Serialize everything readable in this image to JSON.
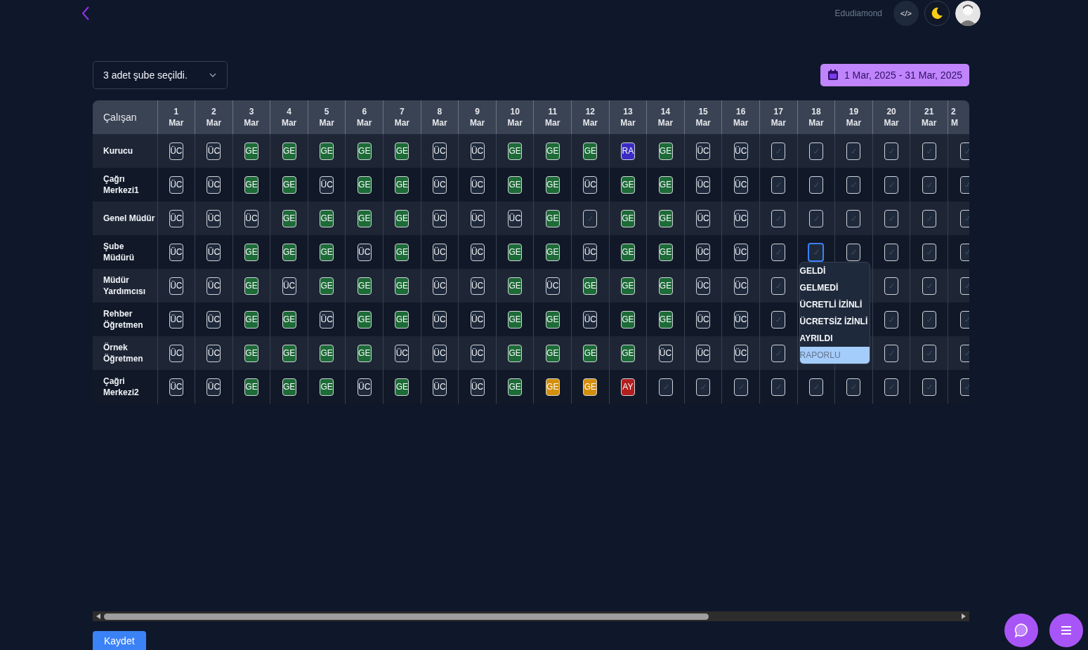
{
  "header": {
    "brand": "Edudiamond",
    "code_button": "</>"
  },
  "branch_select": {
    "value": "3 adet şube seçildi."
  },
  "date_range": {
    "value": "1 Mar, 2025 - 31 Mar, 2025"
  },
  "table": {
    "name_column": "Çalışan",
    "columns": [
      {
        "day": "1",
        "month": "Mar"
      },
      {
        "day": "2",
        "month": "Mar"
      },
      {
        "day": "3",
        "month": "Mar"
      },
      {
        "day": "4",
        "month": "Mar"
      },
      {
        "day": "5",
        "month": "Mar"
      },
      {
        "day": "6",
        "month": "Mar"
      },
      {
        "day": "7",
        "month": "Mar"
      },
      {
        "day": "8",
        "month": "Mar"
      },
      {
        "day": "9",
        "month": "Mar"
      },
      {
        "day": "10",
        "month": "Mar"
      },
      {
        "day": "11",
        "month": "Mar"
      },
      {
        "day": "12",
        "month": "Mar"
      },
      {
        "day": "13",
        "month": "Mar"
      },
      {
        "day": "14",
        "month": "Mar"
      },
      {
        "day": "15",
        "month": "Mar"
      },
      {
        "day": "16",
        "month": "Mar"
      },
      {
        "day": "17",
        "month": "Mar"
      },
      {
        "day": "18",
        "month": "Mar"
      },
      {
        "day": "19",
        "month": "Mar"
      },
      {
        "day": "20",
        "month": "Mar"
      },
      {
        "day": "21",
        "month": "Mar"
      },
      {
        "day": "2",
        "month": "M"
      }
    ],
    "rows": [
      {
        "name": "Kurucu",
        "cells": [
          {
            "kind": "outline",
            "text": "ÜC"
          },
          {
            "kind": "outline",
            "text": "ÜC"
          },
          {
            "kind": "filled",
            "text": "GE",
            "color": "#1d6b37"
          },
          {
            "kind": "filled",
            "text": "GE",
            "color": "#1d6b37"
          },
          {
            "kind": "filled",
            "text": "GE",
            "color": "#1d6b37"
          },
          {
            "kind": "filled",
            "text": "GE",
            "color": "#1d6b37"
          },
          {
            "kind": "filled",
            "text": "GE",
            "color": "#1d6b37"
          },
          {
            "kind": "outline",
            "text": "ÜC"
          },
          {
            "kind": "outline",
            "text": "ÜC"
          },
          {
            "kind": "filled",
            "text": "GE",
            "color": "#1d6b37"
          },
          {
            "kind": "filled",
            "text": "GE",
            "color": "#1d6b37"
          },
          {
            "kind": "filled",
            "text": "GE",
            "color": "#1d6b37"
          },
          {
            "kind": "filled",
            "text": "RA",
            "color": "#3b2bc4"
          },
          {
            "kind": "filled",
            "text": "GE",
            "color": "#1d6b37"
          },
          {
            "kind": "outline",
            "text": "ÜC"
          },
          {
            "kind": "outline",
            "text": "ÜC"
          },
          {
            "kind": "empty"
          },
          {
            "kind": "empty"
          },
          {
            "kind": "empty"
          },
          {
            "kind": "empty"
          },
          {
            "kind": "empty"
          },
          {
            "kind": "empty"
          }
        ]
      },
      {
        "name": "Çağrı Merkezi1",
        "cells": [
          {
            "kind": "outline",
            "text": "ÜC"
          },
          {
            "kind": "outline",
            "text": "ÜC"
          },
          {
            "kind": "filled",
            "text": "GE",
            "color": "#1d6b37"
          },
          {
            "kind": "filled",
            "text": "GE",
            "color": "#1d6b37"
          },
          {
            "kind": "outline",
            "text": "ÜC"
          },
          {
            "kind": "filled",
            "text": "GE",
            "color": "#1d6b37"
          },
          {
            "kind": "filled",
            "text": "GE",
            "color": "#1d6b37"
          },
          {
            "kind": "outline",
            "text": "ÜC"
          },
          {
            "kind": "outline",
            "text": "ÜC"
          },
          {
            "kind": "filled",
            "text": "GE",
            "color": "#1d6b37"
          },
          {
            "kind": "filled",
            "text": "GE",
            "color": "#1d6b37"
          },
          {
            "kind": "outline",
            "text": "ÜC"
          },
          {
            "kind": "filled",
            "text": "GE",
            "color": "#1d6b37"
          },
          {
            "kind": "filled",
            "text": "GE",
            "color": "#1d6b37"
          },
          {
            "kind": "outline",
            "text": "ÜC"
          },
          {
            "kind": "outline",
            "text": "ÜC"
          },
          {
            "kind": "empty"
          },
          {
            "kind": "empty"
          },
          {
            "kind": "empty"
          },
          {
            "kind": "empty"
          },
          {
            "kind": "empty"
          },
          {
            "kind": "empty"
          }
        ]
      },
      {
        "name": "Genel Müdür",
        "cells": [
          {
            "kind": "outline",
            "text": "ÜC"
          },
          {
            "kind": "outline",
            "text": "ÜC"
          },
          {
            "kind": "outline",
            "text": "ÜC"
          },
          {
            "kind": "filled",
            "text": "GE",
            "color": "#1d6b37"
          },
          {
            "kind": "filled",
            "text": "GE",
            "color": "#1d6b37"
          },
          {
            "kind": "filled",
            "text": "GE",
            "color": "#1d6b37"
          },
          {
            "kind": "filled",
            "text": "GE",
            "color": "#1d6b37"
          },
          {
            "kind": "outline",
            "text": "ÜC"
          },
          {
            "kind": "outline",
            "text": "ÜC"
          },
          {
            "kind": "outline",
            "text": "ÜC"
          },
          {
            "kind": "filled",
            "text": "GE",
            "color": "#1d6b37"
          },
          {
            "kind": "empty"
          },
          {
            "kind": "filled",
            "text": "GE",
            "color": "#1d6b37"
          },
          {
            "kind": "filled",
            "text": "GE",
            "color": "#1d6b37"
          },
          {
            "kind": "outline",
            "text": "ÜC"
          },
          {
            "kind": "outline",
            "text": "ÜC"
          },
          {
            "kind": "empty"
          },
          {
            "kind": "empty"
          },
          {
            "kind": "empty"
          },
          {
            "kind": "empty"
          },
          {
            "kind": "empty"
          },
          {
            "kind": "empty"
          }
        ]
      },
      {
        "name": "Şube Müdürü",
        "cells": [
          {
            "kind": "outline",
            "text": "ÜC"
          },
          {
            "kind": "outline",
            "text": "ÜC"
          },
          {
            "kind": "filled",
            "text": "GE",
            "color": "#1d6b37"
          },
          {
            "kind": "filled",
            "text": "GE",
            "color": "#1d6b37"
          },
          {
            "kind": "filled",
            "text": "GE",
            "color": "#1d6b37"
          },
          {
            "kind": "outline",
            "text": "ÜC"
          },
          {
            "kind": "filled",
            "text": "GE",
            "color": "#1d6b37"
          },
          {
            "kind": "outline",
            "text": "ÜC"
          },
          {
            "kind": "outline",
            "text": "ÜC"
          },
          {
            "kind": "filled",
            "text": "GE",
            "color": "#1d6b37"
          },
          {
            "kind": "filled",
            "text": "GE",
            "color": "#1d6b37"
          },
          {
            "kind": "outline",
            "text": "ÜC"
          },
          {
            "kind": "filled",
            "text": "GE",
            "color": "#1d6b37"
          },
          {
            "kind": "filled",
            "text": "GE",
            "color": "#1d6b37"
          },
          {
            "kind": "outline",
            "text": "ÜC"
          },
          {
            "kind": "outline",
            "text": "ÜC"
          },
          {
            "kind": "empty"
          },
          {
            "kind": "focused"
          },
          {
            "kind": "empty"
          },
          {
            "kind": "empty"
          },
          {
            "kind": "empty"
          },
          {
            "kind": "empty"
          }
        ]
      },
      {
        "name": "Müdür Yardımcısı",
        "cells": [
          {
            "kind": "outline",
            "text": "ÜC"
          },
          {
            "kind": "outline",
            "text": "ÜC"
          },
          {
            "kind": "filled",
            "text": "GE",
            "color": "#1d6b37"
          },
          {
            "kind": "outline",
            "text": "ÜC"
          },
          {
            "kind": "filled",
            "text": "GE",
            "color": "#1d6b37"
          },
          {
            "kind": "filled",
            "text": "GE",
            "color": "#1d6b37"
          },
          {
            "kind": "filled",
            "text": "GE",
            "color": "#1d6b37"
          },
          {
            "kind": "outline",
            "text": "ÜC"
          },
          {
            "kind": "outline",
            "text": "ÜC"
          },
          {
            "kind": "filled",
            "text": "GE",
            "color": "#1d6b37"
          },
          {
            "kind": "outline",
            "text": "ÜC"
          },
          {
            "kind": "filled",
            "text": "GE",
            "color": "#1d6b37"
          },
          {
            "kind": "filled",
            "text": "GE",
            "color": "#1d6b37"
          },
          {
            "kind": "filled",
            "text": "GE",
            "color": "#1d6b37"
          },
          {
            "kind": "outline",
            "text": "ÜC"
          },
          {
            "kind": "outline",
            "text": "ÜC"
          },
          {
            "kind": "empty"
          },
          null,
          null,
          {
            "kind": "empty"
          },
          {
            "kind": "empty"
          },
          {
            "kind": "empty"
          }
        ]
      },
      {
        "name": "Rehber Öğretmen",
        "cells": [
          {
            "kind": "outline",
            "text": "ÜC"
          },
          {
            "kind": "outline",
            "text": "ÜC"
          },
          {
            "kind": "filled",
            "text": "GE",
            "color": "#1d6b37"
          },
          {
            "kind": "filled",
            "text": "GE",
            "color": "#1d6b37"
          },
          {
            "kind": "outline",
            "text": "ÜC"
          },
          {
            "kind": "filled",
            "text": "GE",
            "color": "#1d6b37"
          },
          {
            "kind": "filled",
            "text": "GE",
            "color": "#1d6b37"
          },
          {
            "kind": "outline",
            "text": "ÜC"
          },
          {
            "kind": "outline",
            "text": "ÜC"
          },
          {
            "kind": "filled",
            "text": "GE",
            "color": "#1d6b37"
          },
          {
            "kind": "filled",
            "text": "GE",
            "color": "#1d6b37"
          },
          {
            "kind": "outline",
            "text": "ÜC"
          },
          {
            "kind": "filled",
            "text": "GE",
            "color": "#1d6b37"
          },
          {
            "kind": "filled",
            "text": "GE",
            "color": "#1d6b37"
          },
          {
            "kind": "outline",
            "text": "ÜC"
          },
          {
            "kind": "outline",
            "text": "ÜC"
          },
          {
            "kind": "empty"
          },
          null,
          null,
          {
            "kind": "empty"
          },
          {
            "kind": "empty"
          },
          {
            "kind": "empty"
          }
        ]
      },
      {
        "name": "Örnek Öğretmen",
        "cells": [
          {
            "kind": "outline",
            "text": "ÜC"
          },
          {
            "kind": "outline",
            "text": "ÜC"
          },
          {
            "kind": "filled",
            "text": "GE",
            "color": "#1d6b37"
          },
          {
            "kind": "filled",
            "text": "GE",
            "color": "#1d6b37"
          },
          {
            "kind": "filled",
            "text": "GE",
            "color": "#1d6b37"
          },
          {
            "kind": "filled",
            "text": "GE",
            "color": "#1d6b37"
          },
          {
            "kind": "outline",
            "text": "ÜC"
          },
          {
            "kind": "outline",
            "text": "ÜC"
          },
          {
            "kind": "outline",
            "text": "ÜC"
          },
          {
            "kind": "filled",
            "text": "GE",
            "color": "#1d6b37"
          },
          {
            "kind": "filled",
            "text": "GE",
            "color": "#1d6b37"
          },
          {
            "kind": "filled",
            "text": "GE",
            "color": "#1d6b37"
          },
          {
            "kind": "filled",
            "text": "GE",
            "color": "#1d6b37"
          },
          {
            "kind": "outline",
            "text": "ÜC"
          },
          {
            "kind": "outline",
            "text": "ÜC"
          },
          {
            "kind": "outline",
            "text": "ÜC"
          },
          {
            "kind": "empty"
          },
          null,
          null,
          {
            "kind": "empty"
          },
          {
            "kind": "empty"
          },
          {
            "kind": "empty"
          }
        ]
      },
      {
        "name": "Çağri Merkezi2",
        "cells": [
          {
            "kind": "outline",
            "text": "ÜC"
          },
          {
            "kind": "outline",
            "text": "ÜC"
          },
          {
            "kind": "filled",
            "text": "GE",
            "color": "#1d6b37"
          },
          {
            "kind": "filled",
            "text": "GE",
            "color": "#1d6b37"
          },
          {
            "kind": "filled",
            "text": "GE",
            "color": "#1d6b37"
          },
          {
            "kind": "outline",
            "text": "ÜC"
          },
          {
            "kind": "filled",
            "text": "GE",
            "color": "#1d6b37"
          },
          {
            "kind": "outline",
            "text": "ÜC"
          },
          {
            "kind": "outline",
            "text": "ÜC"
          },
          {
            "kind": "filled",
            "text": "GE",
            "color": "#1d6b37"
          },
          {
            "kind": "filled",
            "text": "GE",
            "color": "#d38f0c"
          },
          {
            "kind": "filled",
            "text": "GE",
            "color": "#d38f0c"
          },
          {
            "kind": "filled",
            "text": "AY",
            "color": "#b21e1e"
          },
          {
            "kind": "empty"
          },
          {
            "kind": "empty"
          },
          {
            "kind": "empty"
          },
          {
            "kind": "empty"
          },
          {
            "kind": "empty"
          },
          {
            "kind": "empty"
          },
          {
            "kind": "empty"
          },
          {
            "kind": "empty"
          },
          {
            "kind": "empty"
          }
        ]
      }
    ]
  },
  "status_menu": {
    "items": [
      {
        "label": "GELDİ",
        "selected": false
      },
      {
        "label": "GELMEDİ",
        "selected": false
      },
      {
        "label": "ÜCRETLİ İZİNLİ",
        "selected": false
      },
      {
        "label": "ÜCRETSİZ İZİNLİ",
        "selected": false
      },
      {
        "label": "AYRILDI",
        "selected": false
      },
      {
        "label": "RAPORLU",
        "selected": true
      }
    ]
  },
  "save_button": "Kaydet"
}
